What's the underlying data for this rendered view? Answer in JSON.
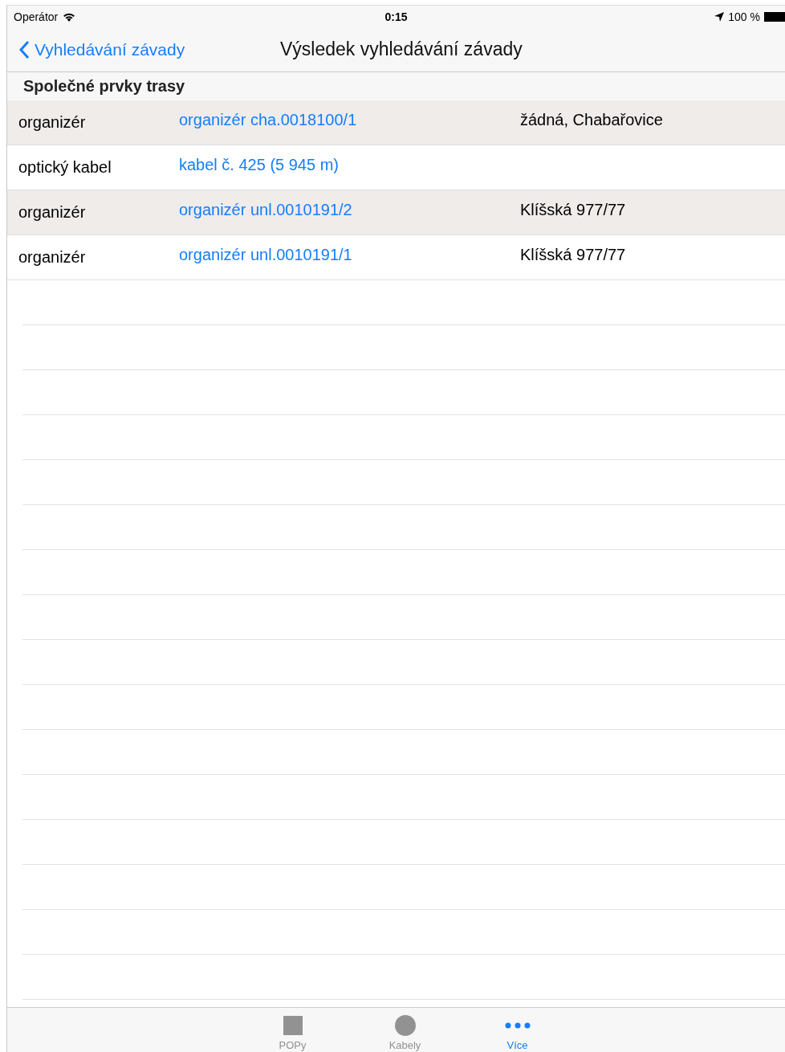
{
  "status_bar": {
    "carrier": "Operátor",
    "time": "0:15",
    "battery": "100 %"
  },
  "nav_bar": {
    "back": "Vyhledávání závady",
    "title": "Výsledek vyhledávání závady"
  },
  "section": {
    "title": "Společné prvky trasy"
  },
  "table": {
    "rows": [
      {
        "type": "organizér",
        "link": "organizér cha.0018100/1",
        "location": "žádná, Chabařovice"
      },
      {
        "type": "optický kabel",
        "link": "kabel č. 425 (5 945 m)"
      },
      {
        "type": "organizér",
        "link": "organizér unl.0010191/2",
        "location": "Klíšská 977/77"
      },
      {
        "type": "organizér",
        "link": "organizér unl.0010191/1",
        "location": "Klíšská 977/77"
      }
    ]
  },
  "tab_bar": [
    {
      "label": "POPy",
      "selected": false
    },
    {
      "label": "Kabely",
      "selected": false
    },
    {
      "label": "Více",
      "selected": true
    }
  ]
}
